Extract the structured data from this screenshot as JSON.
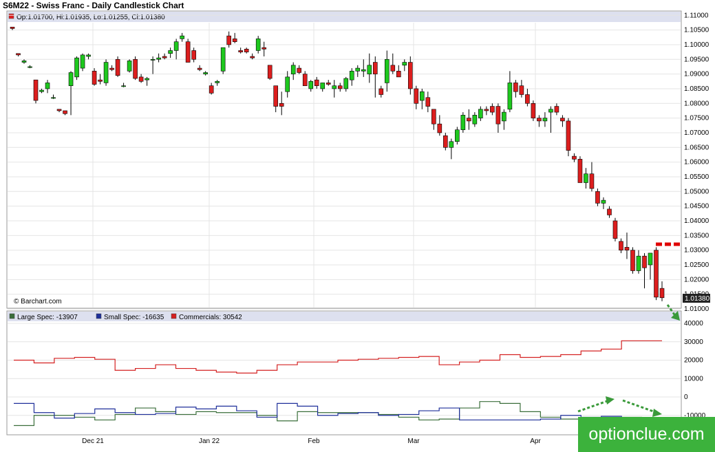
{
  "title": "S6M22 - Swiss Franc - Daily Candlestick Chart",
  "ohlc_text": "Op:1.01700, Hi:1.01935, Lo:1.01255, Cl:1.01380",
  "copyright": "© Barchart.com",
  "last_price_label": "1.01380",
  "watermark": "optionclue.com",
  "colors": {
    "up": "#1ec81e",
    "down": "#dc1e1e",
    "large_spec": "#3a6e3a",
    "small_spec": "#1e2f9a",
    "commercials": "#d42020",
    "highlight": "#e00000",
    "arrow": "#3a9a3a"
  },
  "price_axis_ticks": [
    "1.11000",
    "1.10500",
    "1.10000",
    "1.09500",
    "1.09000",
    "1.08500",
    "1.08000",
    "1.07500",
    "1.07000",
    "1.06500",
    "1.06000",
    "1.05500",
    "1.05000",
    "1.04500",
    "1.04000",
    "1.03500",
    "1.03000",
    "1.02500",
    "1.02000",
    "1.01500",
    "1.01000"
  ],
  "cot_axis_ticks": [
    "40000",
    "30000",
    "20000",
    "10000",
    "0",
    "-10000"
  ],
  "legend": [
    {
      "label": "Large Spec: -13907",
      "color": "#3a6e3a"
    },
    {
      "label": "Small Spec: -16635",
      "color": "#1e2f9a"
    },
    {
      "label": "Commercials: 30542",
      "color": "#d42020"
    }
  ],
  "x_labels": [
    "Dec 21",
    "Jan 22",
    "Feb",
    "Mar",
    "Apr"
  ],
  "chart_data": [
    {
      "type": "candlestick",
      "title": "S6M22 - Swiss Franc - Daily Candlestick Chart",
      "ylim": [
        1.01,
        1.111
      ],
      "last_close": 1.0138,
      "resistance_level": 1.032,
      "ohlc": [
        [
          1.106,
          1.106,
          1.105,
          1.1055
        ],
        [
          1.097,
          1.097,
          1.096,
          1.0965
        ],
        [
          1.094,
          1.095,
          1.0935,
          1.0945
        ],
        [
          1.0925,
          1.093,
          1.092,
          1.0925
        ],
        [
          1.088,
          1.088,
          1.08,
          1.081
        ],
        [
          1.084,
          1.085,
          1.0835,
          1.0845
        ],
        [
          1.085,
          1.088,
          1.0835,
          1.087
        ],
        [
          1.082,
          1.083,
          1.0815,
          1.082
        ],
        [
          1.078,
          1.078,
          1.077,
          1.0775
        ],
        [
          1.0775,
          1.0775,
          1.076,
          1.0765
        ],
        [
          1.086,
          1.091,
          1.076,
          1.0905
        ],
        [
          1.089,
          1.096,
          1.088,
          1.0955
        ],
        [
          1.092,
          1.097,
          1.091,
          1.0965
        ],
        [
          1.096,
          1.097,
          1.095,
          1.0965
        ],
        [
          1.091,
          1.092,
          1.086,
          1.0865
        ],
        [
          1.088,
          1.09,
          1.0865,
          1.0875
        ],
        [
          1.087,
          1.095,
          1.086,
          1.094
        ],
        [
          1.092,
          1.093,
          1.091,
          1.0915
        ],
        [
          1.095,
          1.096,
          1.089,
          1.0895
        ],
        [
          1.086,
          1.087,
          1.0855,
          1.086
        ],
        [
          1.091,
          1.095,
          1.0905,
          1.0945
        ],
        [
          1.095,
          1.096,
          1.088,
          1.0885
        ],
        [
          1.089,
          1.09,
          1.087,
          1.0875
        ],
        [
          1.088,
          1.089,
          1.086,
          1.0885
        ],
        [
          1.095,
          1.096,
          1.09,
          1.095
        ],
        [
          1.095,
          1.097,
          1.094,
          1.0955
        ],
        [
          1.096,
          1.097,
          1.095,
          1.0955
        ],
        [
          1.097,
          1.099,
          1.0955,
          1.098
        ],
        [
          1.098,
          1.102,
          1.095,
          1.101
        ],
        [
          1.102,
          1.104,
          1.101,
          1.103
        ],
        [
          1.101,
          1.102,
          1.094,
          1.094
        ],
        [
          1.098,
          1.099,
          1.094,
          1.095
        ],
        [
          1.092,
          1.093,
          1.091,
          1.0915
        ],
        [
          1.09,
          1.091,
          1.0895,
          1.0905
        ],
        [
          1.086,
          1.087,
          1.083,
          1.0835
        ],
        [
          1.087,
          1.088,
          1.086,
          1.0875
        ],
        [
          1.091,
          1.099,
          1.09,
          1.099
        ],
        [
          1.103,
          1.1045,
          1.099,
          1.1
        ],
        [
          1.102,
          1.104,
          1.1005,
          1.101
        ],
        [
          1.098,
          1.099,
          1.097,
          1.0975
        ],
        [
          1.0985,
          1.099,
          1.097,
          1.0975
        ],
        [
          1.096,
          1.097,
          1.095,
          1.0955
        ],
        [
          1.098,
          1.103,
          1.097,
          1.102
        ],
        [
          1.099,
          1.101,
          1.096,
          1.0985
        ],
        [
          1.093,
          1.093,
          1.088,
          1.0885
        ],
        [
          1.086,
          1.086,
          1.077,
          1.079
        ],
        [
          1.08,
          1.084,
          1.076,
          1.079
        ],
        [
          1.084,
          1.091,
          1.082,
          1.089
        ],
        [
          1.09,
          1.094,
          1.088,
          1.093
        ],
        [
          1.092,
          1.093,
          1.09,
          1.0905
        ],
        [
          1.09,
          1.091,
          1.086,
          1.086
        ],
        [
          1.085,
          1.088,
          1.084,
          1.0875
        ],
        [
          1.088,
          1.089,
          1.085,
          1.086
        ],
        [
          1.085,
          1.087,
          1.084,
          1.087
        ],
        [
          1.087,
          1.088,
          1.086,
          1.0865
        ],
        [
          1.085,
          1.088,
          1.082,
          1.086
        ],
        [
          1.086,
          1.087,
          1.084,
          1.085
        ],
        [
          1.085,
          1.089,
          1.084,
          1.0885
        ],
        [
          1.088,
          1.092,
          1.086,
          1.091
        ],
        [
          1.091,
          1.093,
          1.089,
          1.092
        ],
        [
          1.091,
          1.095,
          1.089,
          1.0915
        ],
        [
          1.09,
          1.097,
          1.087,
          1.093
        ],
        [
          1.094,
          1.096,
          1.082,
          1.09
        ],
        [
          1.085,
          1.086,
          1.082,
          1.083
        ],
        [
          1.087,
          1.098,
          1.084,
          1.095
        ],
        [
          1.093,
          1.097,
          1.09,
          1.091
        ],
        [
          1.091,
          1.093,
          1.089,
          1.089
        ],
        [
          1.093,
          1.095,
          1.091,
          1.094
        ],
        [
          1.094,
          1.096,
          1.083,
          1.085
        ],
        [
          1.085,
          1.086,
          1.078,
          1.08
        ],
        [
          1.081,
          1.085,
          1.078,
          1.084
        ],
        [
          1.082,
          1.084,
          1.077,
          1.079
        ],
        [
          1.078,
          1.078,
          1.071,
          1.073
        ],
        [
          1.073,
          1.076,
          1.069,
          1.07
        ],
        [
          1.069,
          1.07,
          1.064,
          1.065
        ],
        [
          1.065,
          1.068,
          1.061,
          1.067
        ],
        [
          1.067,
          1.072,
          1.066,
          1.071
        ],
        [
          1.071,
          1.077,
          1.07,
          1.076
        ],
        [
          1.075,
          1.078,
          1.071,
          1.074
        ],
        [
          1.073,
          1.077,
          1.072,
          1.076
        ],
        [
          1.075,
          1.079,
          1.074,
          1.078
        ],
        [
          1.078,
          1.079,
          1.076,
          1.0775
        ],
        [
          1.079,
          1.08,
          1.076,
          1.077
        ],
        [
          1.079,
          1.08,
          1.07,
          1.073
        ],
        [
          1.074,
          1.078,
          1.071,
          1.077
        ],
        [
          1.078,
          1.091,
          1.077,
          1.087
        ],
        [
          1.087,
          1.088,
          1.082,
          1.084
        ],
        [
          1.086,
          1.088,
          1.082,
          1.083
        ],
        [
          1.083,
          1.085,
          1.079,
          1.08
        ],
        [
          1.08,
          1.081,
          1.074,
          1.075
        ],
        [
          1.075,
          1.076,
          1.072,
          1.074
        ],
        [
          1.074,
          1.077,
          1.072,
          1.075
        ],
        [
          1.077,
          1.079,
          1.07,
          1.078
        ],
        [
          1.079,
          1.08,
          1.076,
          1.077
        ],
        [
          1.075,
          1.076,
          1.072,
          1.074
        ],
        [
          1.074,
          1.075,
          1.062,
          1.064
        ],
        [
          1.062,
          1.063,
          1.06,
          1.061
        ],
        [
          1.061,
          1.062,
          1.053,
          1.053
        ],
        [
          1.053,
          1.058,
          1.051,
          1.056
        ],
        [
          1.056,
          1.06,
          1.05,
          1.051
        ],
        [
          1.05,
          1.051,
          1.045,
          1.046
        ],
        [
          1.046,
          1.048,
          1.044,
          1.047
        ],
        [
          1.044,
          1.045,
          1.041,
          1.042
        ],
        [
          1.04,
          1.041,
          1.033,
          1.034
        ],
        [
          1.033,
          1.034,
          1.029,
          1.03
        ],
        [
          1.031,
          1.036,
          1.027,
          1.03
        ],
        [
          1.03,
          1.031,
          1.022,
          1.023
        ],
        [
          1.023,
          1.03,
          1.022,
          1.028
        ],
        [
          1.028,
          1.029,
          1.017,
          1.024
        ],
        [
          1.025,
          1.029,
          1.02,
          1.029
        ],
        [
          1.03,
          1.031,
          1.013,
          1.014
        ],
        [
          1.017,
          1.0194,
          1.0126,
          1.0138
        ]
      ]
    },
    {
      "type": "line",
      "title": "COT positions",
      "ylim": [
        -10000,
        45000
      ],
      "series": [
        {
          "name": "Large Spec",
          "values": [
            -15500,
            -10000,
            -10000,
            -11000,
            -12500,
            -9500,
            -6000,
            -8000,
            -9500,
            -8000,
            -8500,
            -8500,
            -10000,
            -13000,
            -8000,
            -8500,
            -8500,
            -8500,
            -9500,
            -11000,
            -12500,
            -12000,
            -6000,
            -2500,
            -3500,
            -8000,
            -11000,
            -12000,
            -13000,
            -12000,
            -11000,
            -13000,
            -13907
          ]
        },
        {
          "name": "Small Spec",
          "values": [
            -3500,
            -8500,
            -11500,
            -9000,
            -6500,
            -8500,
            -9500,
            -9000,
            -5500,
            -6500,
            -5000,
            -7500,
            -11000,
            -3500,
            -5000,
            -10000,
            -9000,
            -8500,
            -10000,
            -9500,
            -7500,
            -6000,
            -12500,
            -12500,
            -12500,
            -12500,
            -12000,
            -10000,
            -11000,
            -10500,
            -14500,
            -16635,
            -16635
          ]
        },
        {
          "name": "Commercials",
          "values": [
            20000,
            18500,
            21000,
            21500,
            20500,
            14500,
            15500,
            17500,
            15500,
            14500,
            13500,
            13000,
            14500,
            17500,
            19000,
            19000,
            20000,
            20500,
            21000,
            21500,
            22000,
            17500,
            19000,
            20000,
            23000,
            21500,
            22000,
            23000,
            25000,
            26000,
            30542,
            30542,
            30542
          ]
        }
      ]
    }
  ]
}
